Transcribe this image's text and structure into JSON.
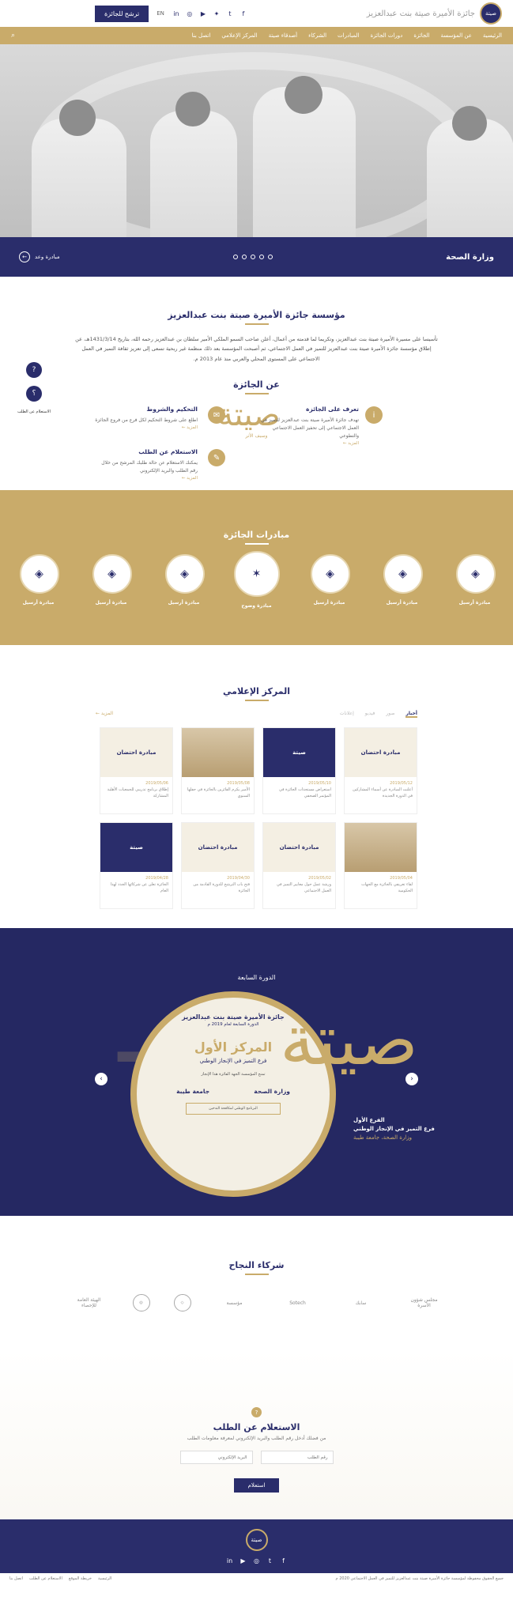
{
  "header": {
    "logo_text": "جائزة الأميرة صيتة بنت عبدالعزيز",
    "logo_badge": "صيتة",
    "nominate": "ترشح للجائزة",
    "lang": "EN",
    "social": [
      "in",
      "◎",
      "▶",
      "✦",
      "t",
      "f"
    ]
  },
  "nav": {
    "items": [
      "الرئيسية",
      "عن المؤسسة",
      "الجائزة",
      "دورات الجائزة",
      "المبادرات",
      "الشركاء",
      "أصدقاء صيتة",
      "المركز الإعلامي",
      "اتصل بنا"
    ],
    "search": "⌕"
  },
  "hero": {
    "title": "وزارة الصحة",
    "link": "مبادرة وعد"
  },
  "about": {
    "title": "مؤسسة جائزة الأميرة صيتة بنت عبدالعزيز",
    "text": "تأسيسا على مسيرة الأميرة صيتة بنت عبدالعزيز، وتكريما لما قدمته من أعمال، أعلن صاحب السمو الملكي الأمير سلطان بن عبدالعزيز رحمه الله، بتاريخ 1431/3/14هـ، عن إطلاق مؤسسة جائزة الأميرة صيتة بنت عبدالعزيز للتميز في العمل الاجتماعي، ثم أصبحت المؤسسة بعد ذلك منظمة غير ربحية تسعى إلى تعزيز ثقافة التميز في العمل الاجتماعي على المستوى المحلي والعربي منذ عام 2013 م."
  },
  "side": {
    "label": "الاستعلام عن الطلب"
  },
  "award": {
    "title": "عن الجائزة",
    "logo": "صيتة",
    "logo_sub": "وسيف الأثر",
    "items": [
      {
        "title": "تعرف على الجائزة",
        "text": "تهدف جائزة الأميرة صيتة بنت عبدالعزيز للتميز في العمل الاجتماعي إلى تحفيز العمل الاجتماعي والتطوعي",
        "more": "المزيد ←"
      },
      {
        "title": "التحكيم والشروط",
        "text": "اطلع على شروط التحكيم لكل فرع من فروع الجائزة",
        "more": "المزيد ←"
      },
      {
        "title": "الاستعلام عن الطلب",
        "text": "يمكنك الاستعلام عن حالة طلبك المرشح من خلال رقم الطلب والبريد الإلكتروني",
        "more": "المزيد ←"
      }
    ]
  },
  "initiatives": {
    "title": "مبادرات الجائزة",
    "items": [
      {
        "name": "مبادرة أرسيل"
      },
      {
        "name": "مبادرة أرسيل"
      },
      {
        "name": "مبادرة أرسيل"
      },
      {
        "name": "مبادرة وضوح"
      },
      {
        "name": "مبادرة أرسيل"
      },
      {
        "name": "مبادرة أرسيل"
      },
      {
        "name": "مبادرة أرسيل"
      }
    ]
  },
  "media": {
    "title": "المركز الإعلامي",
    "tabs": [
      "أخبار",
      "صور",
      "فيديو",
      "إعلانات"
    ],
    "more": "المزيد ←",
    "cards": [
      {
        "thumb": "مبادرة احتضان",
        "date": "2019/05/12",
        "text": "أعلنت المبادرة عن أسماء المشاركين في الدورة الجديدة"
      },
      {
        "thumb": "صيتة",
        "date": "2019/05/10",
        "text": "استعراض مستجدات الجائزة في المؤتمر الصحفي"
      },
      {
        "thumb": "",
        "date": "2019/05/08",
        "text": "الأمير يكرم الفائزين بالجائزة في حفلها السنوي"
      },
      {
        "thumb": "مبادرة احتضان",
        "date": "2019/05/06",
        "text": "إطلاق برنامج تدريبي للجمعيات الأهلية المشاركة"
      },
      {
        "thumb": "",
        "date": "2019/05/04",
        "text": "لقاء تعريفي بالجائزة مع الجهات الحكومية"
      },
      {
        "thumb": "مبادرة احتضان",
        "date": "2019/05/02",
        "text": "ورشة عمل حول معايير التميز في العمل الاجتماعي"
      },
      {
        "thumb": "مبادرة احتضان",
        "date": "2019/04/30",
        "text": "فتح باب الترشح للدورة القادمة من الجائزة"
      },
      {
        "thumb": "صيتة",
        "date": "2019/04/28",
        "text": "الجائزة تعلن عن شركائها الجدد لهذا العام"
      }
    ]
  },
  "cycle": {
    "title": "الدورة السابعة",
    "ring_title": "جائزة الأميرة صيتة بنت عبدالعزيز",
    "ring_sub": "الدورة السابعة لعام 2019 م",
    "ring_rank": "المركز الأول",
    "ring_branch": "فرع التميز في الإنجاز الوطني",
    "ring_note": "تمنح المؤسسة الجهة الفائزة هذا الإنجاز",
    "org1": "وزارة الصحة",
    "org2": "جامعة طيبة",
    "box": "البرنامج الوطني لمكافحة التدخين",
    "logo": "صيتة",
    "logo_sub": "وسيف الأثر",
    "info_a": "الفرع الأول",
    "info_b": "فرع التميز في الإنجاز الوطني",
    "info_c": "وزارة الصحة، جامعة طيبة",
    "prev": "‹",
    "next": "›"
  },
  "partners": {
    "title": "شركاء النجاح",
    "logos": [
      "مجلس شؤون الأسرة",
      "سابك",
      "Sotech",
      "مؤسسة",
      "",
      "",
      "الهيئة العامة للإحصاء"
    ]
  },
  "inquiry": {
    "title": "الاستعلام عن الطلب",
    "desc": "من فضلك أدخل رقم الطلب والبريد الإلكتروني لمعرفة معلومات الطلب",
    "field1": "رقم الطلب",
    "field2": "البريد الإلكتروني",
    "button": "استعلام"
  },
  "footer": {
    "badge": "صيتة",
    "social": [
      "f",
      "t",
      "◎",
      "▶",
      "in"
    ],
    "copyright": "جميع الحقوق محفوظة لمؤسسة جائزة الأميرة صيتة بنت عبدالعزيز للتميز في العمل الاجتماعي 2020 م",
    "links": [
      "الرئيسية",
      "خريطة الموقع",
      "الاستعلام عن الطلب",
      "اتصل بنا"
    ]
  }
}
